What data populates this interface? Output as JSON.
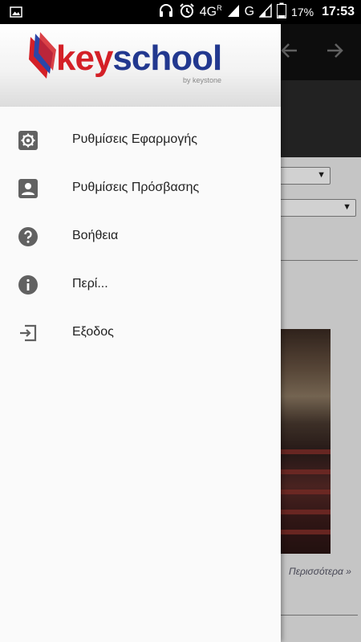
{
  "status_bar": {
    "network": "4G",
    "network_sup": "R",
    "signal2": "G",
    "battery": "17%",
    "time": "17:53"
  },
  "background": {
    "more_link": "Περισσότερα »"
  },
  "drawer": {
    "logo": {
      "key": "key",
      "school": "school",
      "tagline": "by keystone"
    },
    "items": [
      {
        "label": "Ρυθμίσεις Εφαρμογής",
        "icon": "gear-icon"
      },
      {
        "label": "Ρυθμίσεις Πρόσβασης",
        "icon": "account-box-icon"
      },
      {
        "label": "Βοήθεια",
        "icon": "help-icon"
      },
      {
        "label": "Περί...",
        "icon": "info-icon"
      },
      {
        "label": "Εξοδος",
        "icon": "exit-icon"
      }
    ]
  },
  "colors": {
    "brand_red": "#d42027",
    "brand_blue": "#22388f",
    "icon_gray": "#616161"
  }
}
